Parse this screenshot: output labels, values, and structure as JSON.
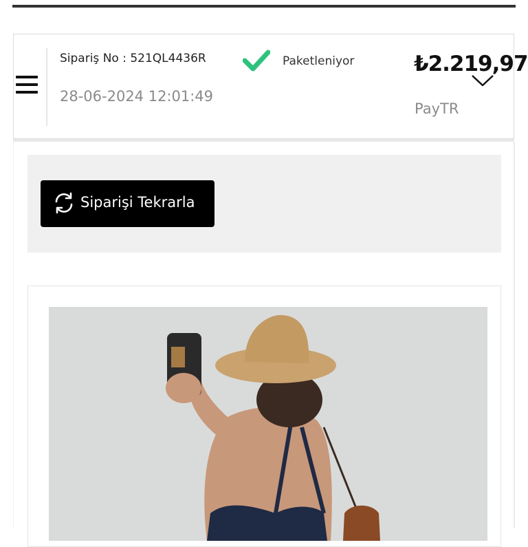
{
  "order": {
    "number_text": "Sipariş No : 521QL4436R",
    "date": "28-06-2024 12:01:49",
    "status": "Paketleniyor",
    "price": "₺2.219,97",
    "payment_method": "PayTR"
  },
  "actions": {
    "reorder_label": "Siparişi Tekrarla"
  },
  "icons": {
    "menu": "hamburger-menu-icon",
    "status": "checkmark-icon",
    "price_expand": "chevron-down-icon",
    "reorder": "refresh-icon"
  },
  "colors": {
    "status_check": "#2ec27e",
    "button_bg": "#000000",
    "panel_bg": "#f0f0f0"
  }
}
